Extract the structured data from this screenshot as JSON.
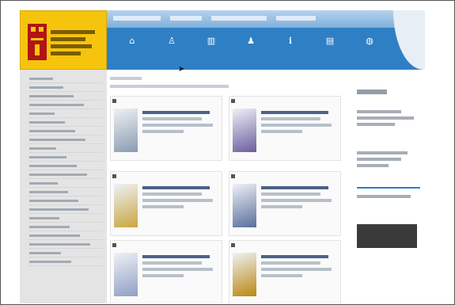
{
  "colors": {
    "banner": "#2f7fc5",
    "logo_yellow": "#f6c40d",
    "emblem_red": "#b01414",
    "sidebar": "#e4e4e4"
  },
  "header": {
    "logo_icon": "coat-of-arms-icon",
    "nav": [
      {
        "icon": "home-icon",
        "glyph": "⌂"
      },
      {
        "icon": "person-icon",
        "glyph": "♙"
      },
      {
        "icon": "building-icon",
        "glyph": "▥"
      },
      {
        "icon": "people-icon",
        "glyph": "♟"
      },
      {
        "icon": "info-icon",
        "glyph": "ℹ"
      },
      {
        "icon": "document-icon",
        "glyph": "▤"
      },
      {
        "icon": "globe-icon",
        "glyph": "◍"
      }
    ]
  },
  "sidebar": {
    "items": [
      "",
      "",
      "",
      "",
      "",
      "",
      "",
      "",
      "",
      "",
      "",
      "",
      "",
      "",
      "",
      "",
      "",
      "",
      "",
      "",
      "",
      ""
    ]
  },
  "main": {
    "boxes": [
      {
        "thumb": "#8a9bb0"
      },
      {
        "thumb": "#6b5c9e"
      },
      {
        "thumb": "#c9a640"
      },
      {
        "thumb": "#5a6e9a"
      },
      {
        "thumb": "#8f9fc4"
      },
      {
        "thumb": "#b9880f"
      }
    ]
  }
}
